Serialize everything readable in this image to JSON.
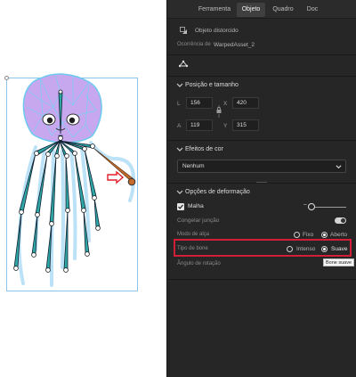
{
  "panel": {
    "tabs": [
      {
        "label": "Ferramenta"
      },
      {
        "label": "Objeto",
        "active": true
      },
      {
        "label": "Quadro"
      },
      {
        "label": "Doc"
      }
    ],
    "object": {
      "type_label": "Objeto distorcido",
      "instance_caption": "Ocorrência de",
      "instance_name": "WarpedAsset_2"
    },
    "position_size": {
      "title": "Posição e tamanho",
      "l_label": "L",
      "l_value": "156",
      "x_label": "X",
      "x_value": "420",
      "a_label": "A",
      "a_value": "119",
      "y_label": "Y",
      "y_value": "315"
    },
    "color_effects": {
      "title": "Efeitos de cor",
      "select_value": "Nenhum"
    },
    "deform_options": {
      "title": "Opções de deformação",
      "mesh_label": "Malha",
      "mesh_checked": true,
      "mesh_slider_minus": "–",
      "mesh_slider_value": 0.1,
      "freeze_joint_label": "Congelar junção",
      "freeze_joint_on": true,
      "handle_mode_label": "Modo de alça",
      "handle_mode_options": [
        "Fixo",
        "Aberto"
      ],
      "handle_mode_selected": "Aberto",
      "bone_type_label": "Tipo de bone",
      "bone_type_options": [
        "Intenso",
        "Suave"
      ],
      "bone_type_selected": "Suave",
      "bone_type_tooltip": "Bone suave",
      "rotation_angle_label": "Ângulo de rotação"
    }
  },
  "colors": {
    "panel_bg": "#262626",
    "highlight_border": "#d21f37",
    "bone_fill": "#2fa6a6",
    "artboard_border": "#8fc4ea",
    "selected_bone": "#c46a2a",
    "arrow": "#e01f28",
    "creature_body": "#c7a8ef"
  },
  "icons": [
    "warped-object-icon",
    "mesh-tool-icon",
    "chevron-down-icon",
    "link-icon",
    "arrow-right-icon"
  ]
}
